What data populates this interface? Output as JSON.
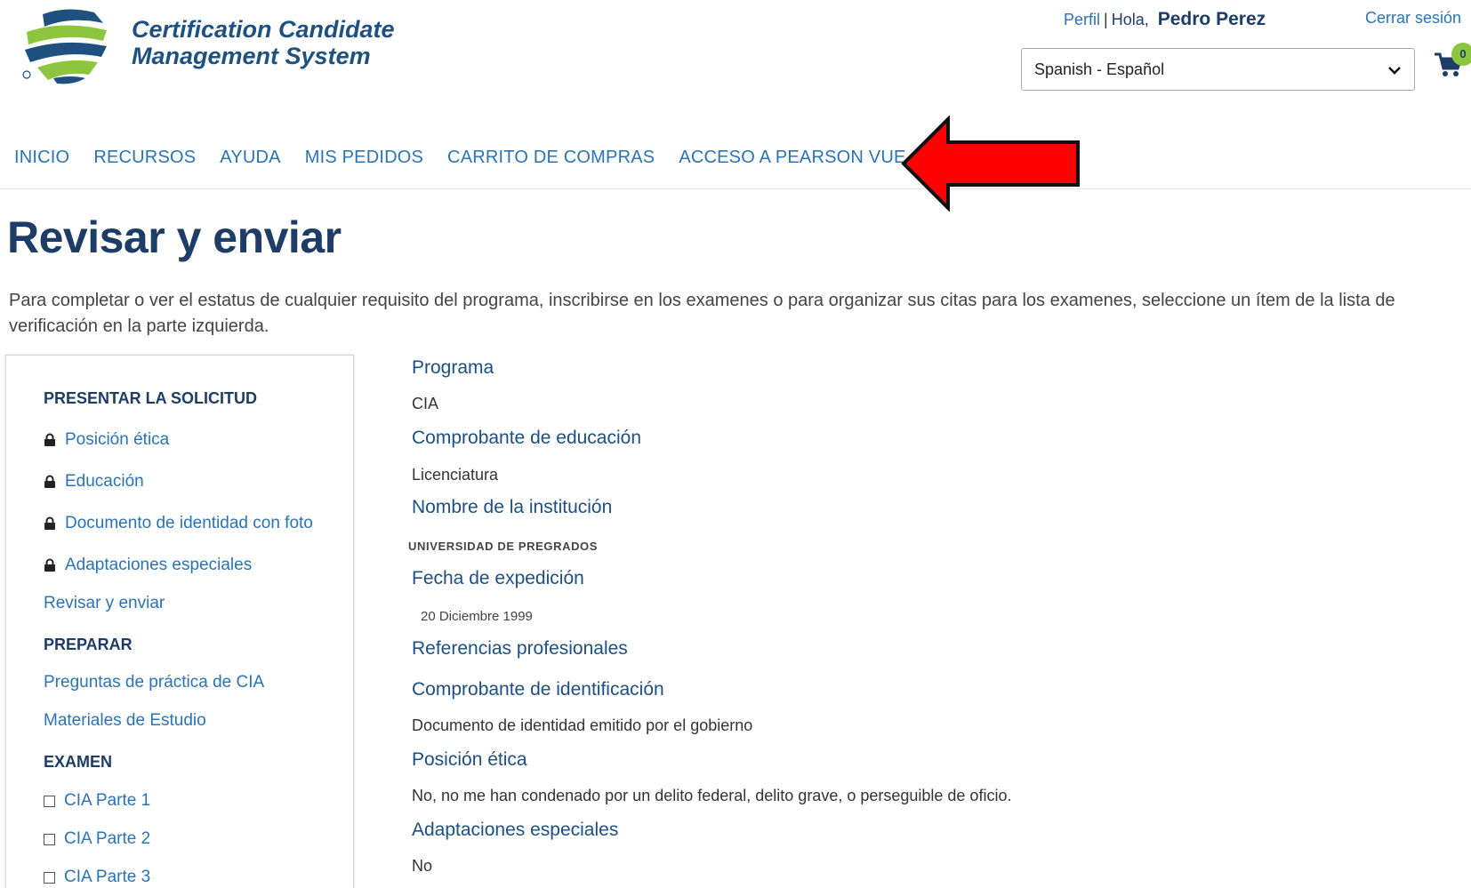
{
  "header": {
    "logo_line1": "Certification Candidate",
    "logo_line2": "Management System",
    "profile_link": "Perfil",
    "separator": "|",
    "greeting": "Hola,",
    "user_name": "Pedro Perez",
    "logout_link": "Cerrar sesión",
    "language_selected": "Spanish - Español",
    "cart_count": "0"
  },
  "nav": {
    "items": [
      "INICIO",
      "RECURSOS",
      "AYUDA",
      "MIS PEDIDOS",
      "CARRITO DE COMPRAS",
      "ACCESO A PEARSON VUE"
    ]
  },
  "page": {
    "title": "Revisar y enviar",
    "intro": "Para completar o ver el estatus de cualquier requisito del programa, inscribirse en los examenes o para organizar sus citas para los examenes, seleccione un ítem de la lista de verificación en la parte izquierda."
  },
  "sidebar": {
    "section1": "PRESENTAR LA SOLICITUD",
    "apply_items": [
      "Posición ética",
      "Educación",
      "Documento de identidad con foto",
      "Adaptaciones especiales"
    ],
    "review_link": "Revisar y enviar",
    "section2": "PREPARAR",
    "prepare_items": [
      "Preguntas de práctica de CIA",
      "Materiales de Estudio"
    ],
    "section3": "EXAMEN",
    "exam_items": [
      "CIA Parte 1",
      "CIA Parte 2",
      "CIA Parte 3"
    ]
  },
  "details": {
    "program_label": "Programa",
    "program_value": "CIA",
    "education_label": "Comprobante de educación",
    "education_value": "Licenciatura",
    "institution_label": "Nombre de la institución",
    "institution_value": "UNIVERSIDAD DE PREGRADOS",
    "issue_date_label": "Fecha de expedición",
    "issue_date_value": "20 Diciembre 1999",
    "references_label": "Referencias profesionales",
    "id_proof_label": "Comprobante de identificación",
    "id_proof_value": "Documento de identidad emitido por el gobierno",
    "ethics_label": "Posición ética",
    "ethics_value": "No, no me han condenado por un delito federal, delito grave, o perseguible de oficio.",
    "accommodations_label": "Adaptaciones especiales",
    "accommodations_value": "No"
  },
  "colors": {
    "primary_blue": "#1d3c66",
    "link_blue": "#2a73b5",
    "logo_green": "#8cc63f",
    "arrow_red": "#ff0000"
  },
  "icons": [
    "globe-logo-icon",
    "chevron-down-icon",
    "cart-icon",
    "lock-icon",
    "checkbox-icon",
    "red-arrow-icon"
  ]
}
